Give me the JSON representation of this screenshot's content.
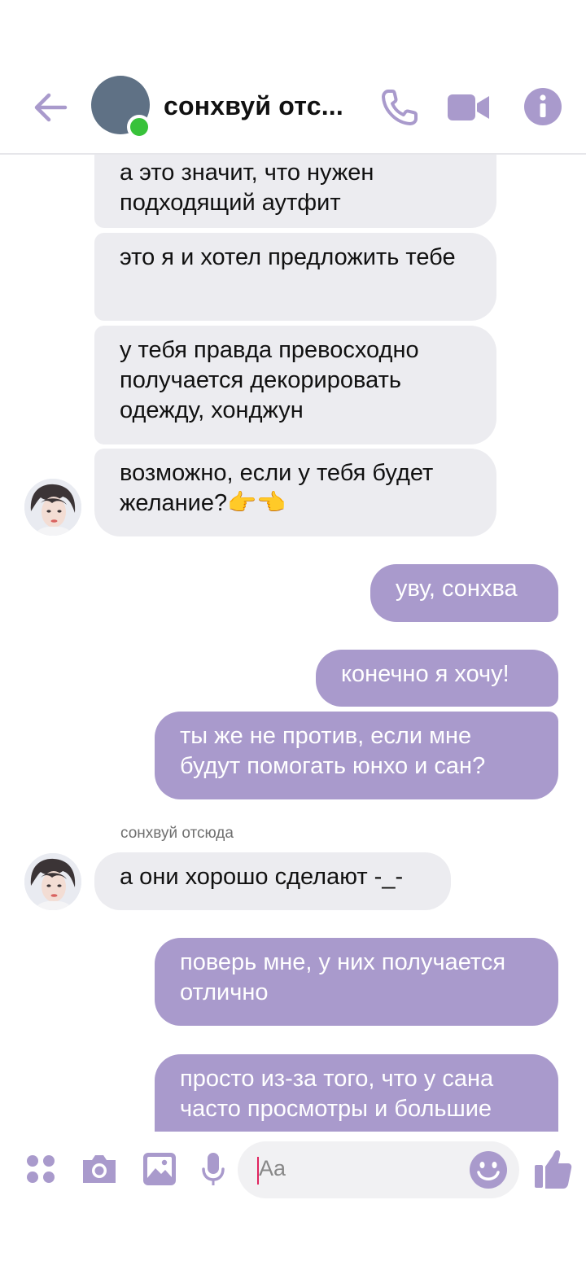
{
  "header": {
    "back_icon": "arrow-left-icon",
    "title": "сонхвуй отс...",
    "call_icon": "phone-icon",
    "video_icon": "video-camera-icon",
    "info_icon": "info-icon",
    "accent_color": "#a99acc",
    "online_color": "#38c23a"
  },
  "messages": [
    {
      "side": "in",
      "text": "а это значит, что нужен подходящий аутфит"
    },
    {
      "side": "in",
      "text": "это я и хотел предложить тебе"
    },
    {
      "side": "in",
      "text": "у тебя правда превосходно получается декорировать одежду, хонджун"
    },
    {
      "side": "in",
      "text": "возможно, если у тебя будет желание?👉👈"
    },
    {
      "side": "out",
      "text": "уву, сонхва"
    },
    {
      "side": "out",
      "text": "конечно я хочу!"
    },
    {
      "side": "out",
      "text": "ты же не против, если мне будут помогать юнхо и сан?"
    },
    {
      "side": "in",
      "sender": "сонхвуй отсюда",
      "text": "а они хорошо сделают -_-"
    },
    {
      "side": "out",
      "text": "поверь мне, у них получается отлично"
    },
    {
      "side": "out",
      "text": "просто из-за того, что у сана часто просмотры и большие"
    }
  ],
  "composer": {
    "apps_icon": "four-dots-icon",
    "camera_icon": "camera-icon",
    "gallery_icon": "image-icon",
    "mic_icon": "microphone-icon",
    "placeholder": "Aa",
    "emoji_icon": "smiley-icon",
    "like_icon": "thumbs-up-icon"
  },
  "colors": {
    "incoming_bubble": "#ececf0",
    "outgoing_bubble": "#a99acc"
  }
}
